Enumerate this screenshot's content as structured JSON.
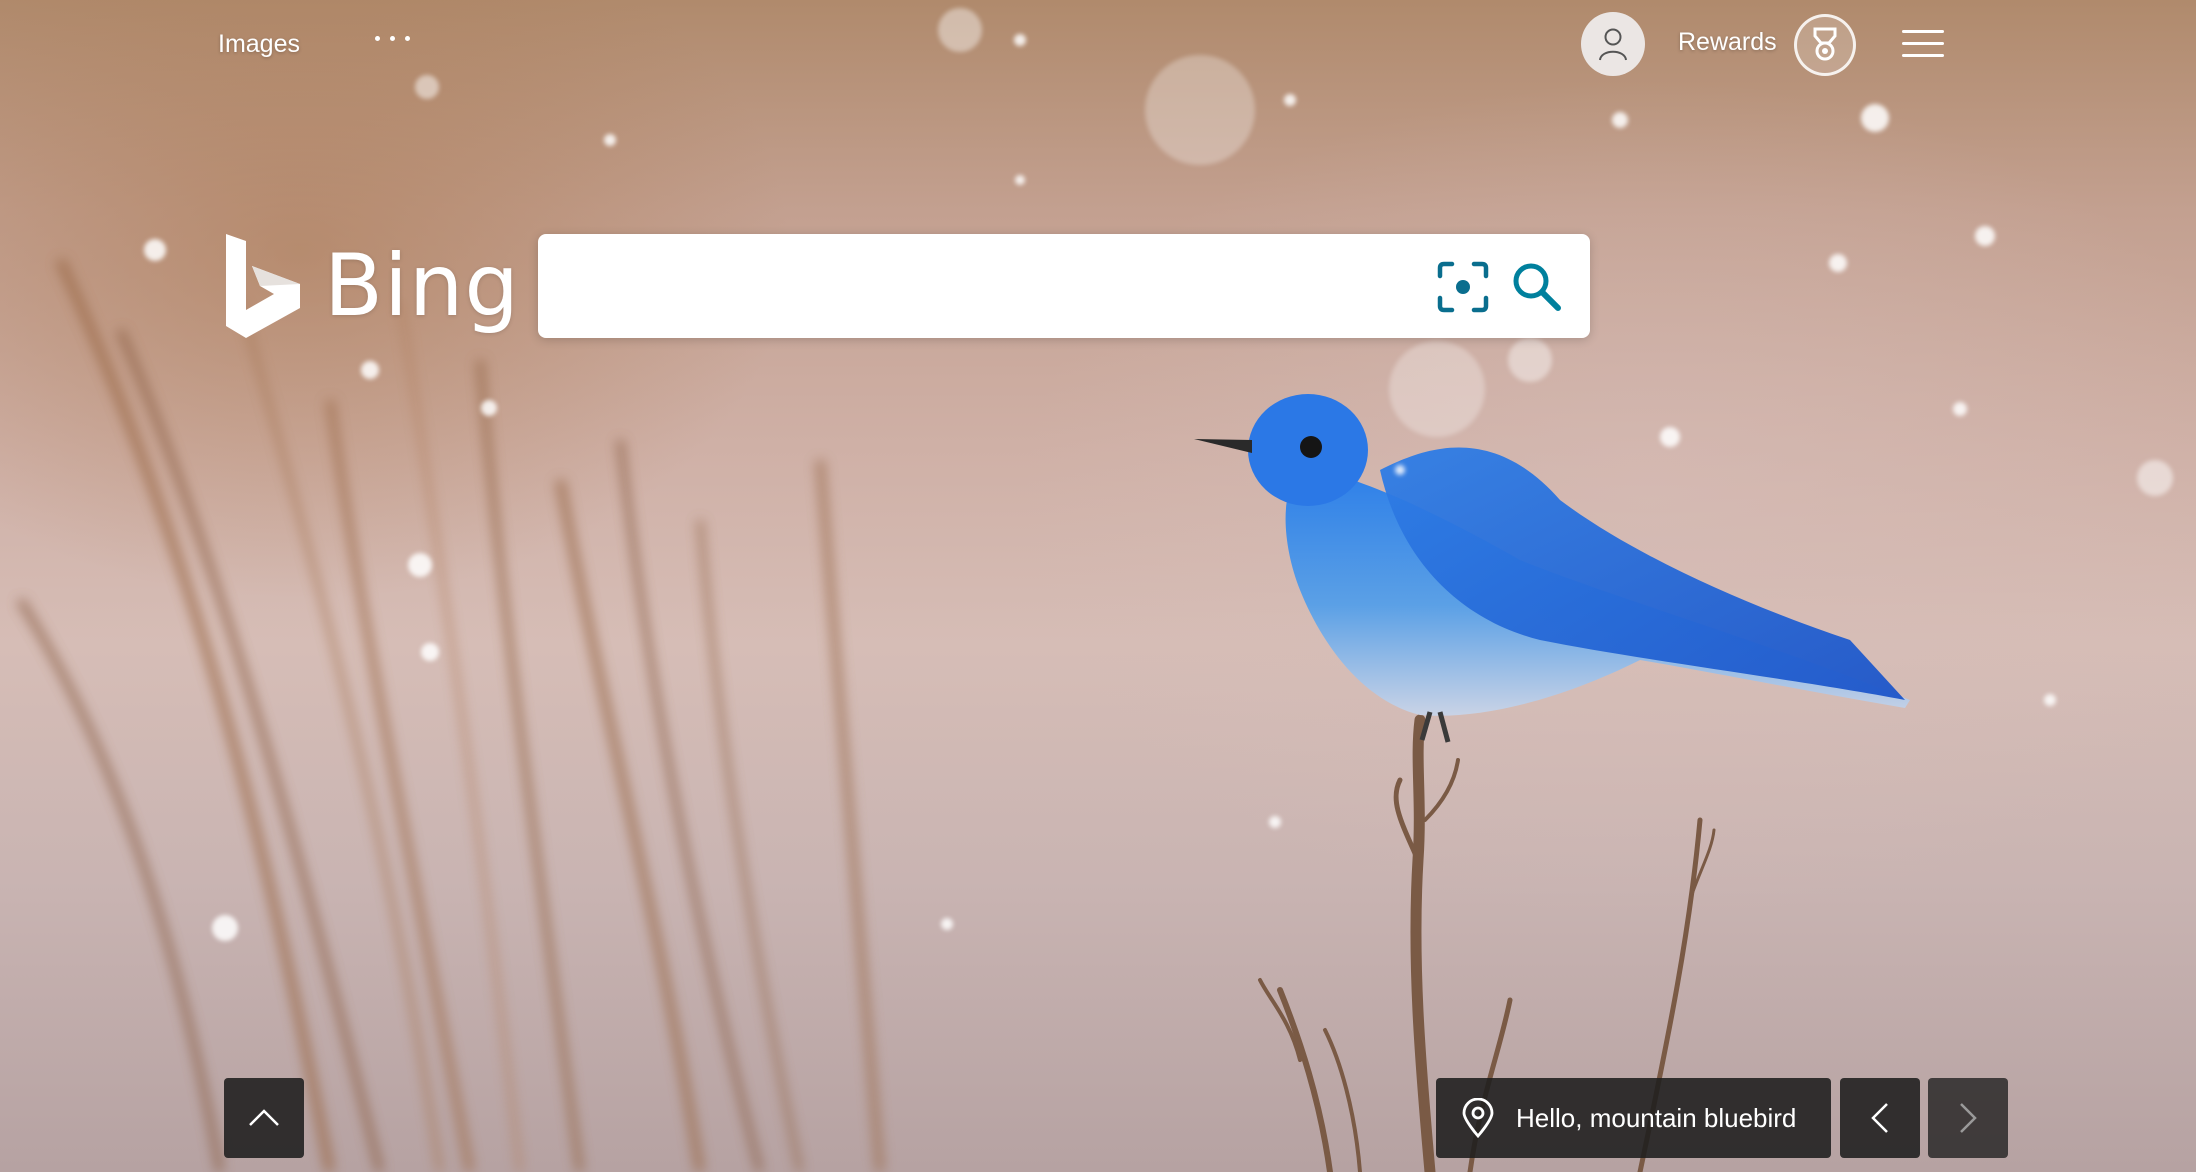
{
  "topbar": {
    "images_label": "Images",
    "more_icon": "ellipsis-icon",
    "avatar_icon": "user-icon",
    "rewards_label": "Rewards",
    "rewards_icon": "medal-icon",
    "menu_icon": "hamburger-icon"
  },
  "logo": {
    "text": "Bing"
  },
  "search": {
    "value": "",
    "placeholder": "",
    "visual_search_icon": "visual-search-icon",
    "search_icon": "search-icon"
  },
  "bottom": {
    "scroll_up_icon": "chevron-up-icon",
    "caption_icon": "location-pin-icon",
    "caption_text": "Hello, mountain bluebird",
    "prev_icon": "chevron-left-icon",
    "next_icon": "chevron-right-icon"
  },
  "colors": {
    "accent": "#00809d",
    "bird_blue": "#2f7fe0",
    "control_bg": "#1e1e1e"
  }
}
